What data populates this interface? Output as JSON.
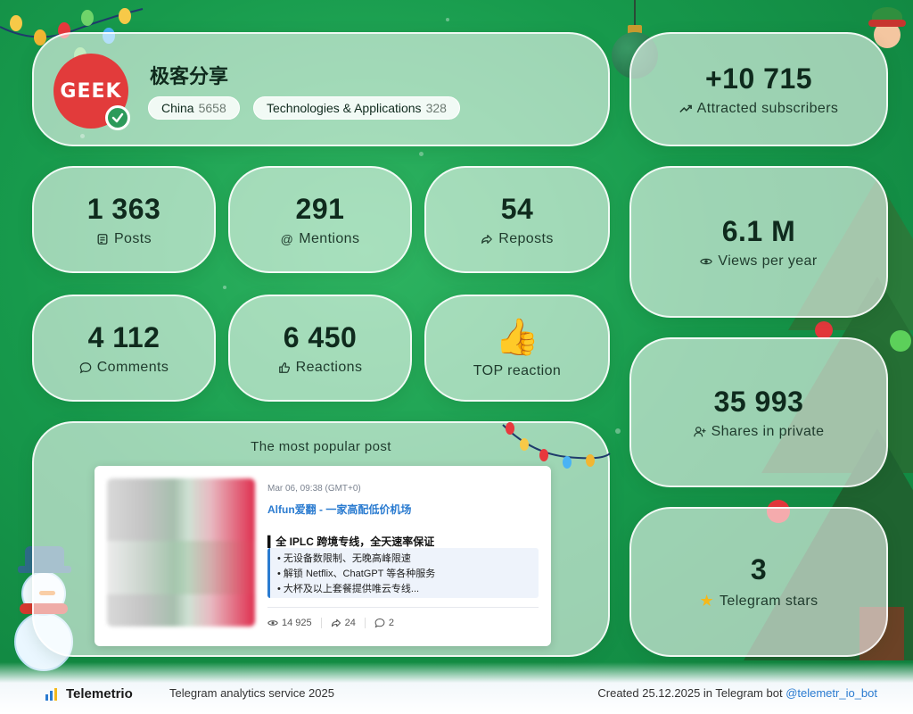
{
  "channel": {
    "name": "极客分享",
    "logo_text": "GEEK",
    "tags": [
      {
        "label": "China",
        "count": "5658"
      },
      {
        "label": "Technologies & Applications",
        "count": "328"
      }
    ]
  },
  "stats": {
    "posts": {
      "value": "1 363",
      "label": "Posts"
    },
    "mentions": {
      "value": "291",
      "label": "Mentions"
    },
    "reposts": {
      "value": "54",
      "label": "Reposts"
    },
    "comments": {
      "value": "4 112",
      "label": "Comments"
    },
    "reactions": {
      "value": "6 450",
      "label": "Reactions"
    },
    "top_reaction": {
      "emoji": "👍",
      "label": "TOP reaction"
    },
    "subscribers": {
      "value": "+10 715",
      "label": "Attracted subscribers"
    },
    "views": {
      "value": "6.1 M",
      "label": "Views per year"
    },
    "shares": {
      "value": "35 993",
      "label": "Shares in private"
    },
    "stars": {
      "value": "3",
      "label": "Telegram stars"
    }
  },
  "popular_post": {
    "title": "The most popular post",
    "date": "Mar 06, 09:38 (GMT+0)",
    "link": "Alfun爱翻 - 一家高配低价机场",
    "headline": "▍全 IPLC 跨境专线，全天速率保证",
    "bullets": [
      "• 无设备数限制、无晚高峰限速",
      "• 解锁 Netflix、ChatGPT 等各种服务",
      "• 大杯及以上套餐提供唯云专线..."
    ],
    "views": "14 925",
    "reposts": "24",
    "comments": "2"
  },
  "footer": {
    "brand": "Telemetrio",
    "service": "Telegram analytics service 2025",
    "created": "Created 25.12.2025 in Telegram bot",
    "bot": "@telemetr_io_bot"
  },
  "colors": {
    "background": "#179a4c",
    "logo_red": "#e23b3b",
    "link_blue": "#2a7bd0"
  }
}
